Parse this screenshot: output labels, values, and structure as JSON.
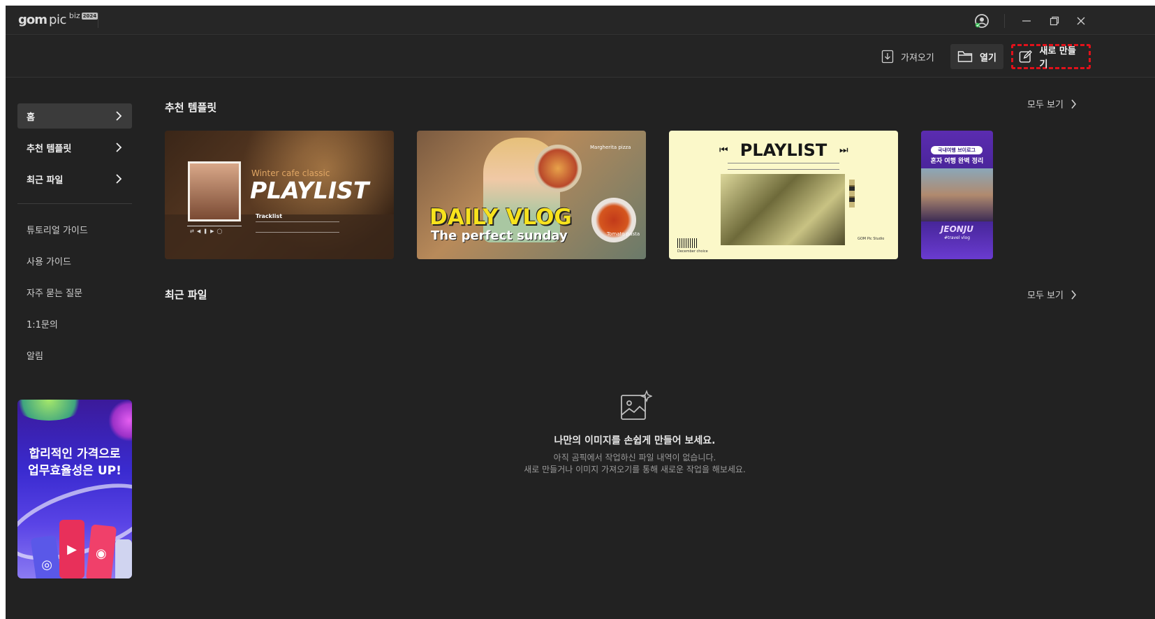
{
  "app": {
    "logo": {
      "brand": "gom",
      "product": "pic",
      "edition": "biz",
      "year": "2024"
    }
  },
  "toolbar": {
    "import_label": "가져오기",
    "open_label": "열기",
    "new_label": "새로 만들기"
  },
  "sidebar": {
    "nav": [
      {
        "label": "홈",
        "active": true
      },
      {
        "label": "추천 템플릿",
        "active": false
      },
      {
        "label": "최근 파일",
        "active": false
      }
    ],
    "guides": [
      "튜토리얼 가이드",
      "사용 가이드",
      "자주 묻는 질문",
      "1:1문의",
      "알림"
    ],
    "ad": {
      "line1": "합리적인 가격으로",
      "line2": "업무효율성은 UP!"
    }
  },
  "main": {
    "templates_title": "추천 템플릿",
    "recent_title": "최근 파일",
    "see_all": "모두 보기",
    "templates": [
      {
        "subtitle": "Winter cafe classic",
        "title": "PLAYLIST",
        "tracklist": "Tracklist"
      },
      {
        "title": "DAILY VLOG",
        "subtitle": "The perfect sunday",
        "note1": "Margherita pizza",
        "note2": "Tomato pasta"
      },
      {
        "title": "PLAYLIST",
        "footer": "December choice",
        "studio": "GOM Pic Studio"
      },
      {
        "tag": "국내여행 브이로그",
        "headline": "혼자 여행 완벽 정리",
        "title": "JEONJU",
        "sub": "#travel vlog"
      }
    ],
    "empty": {
      "title": "나만의 이미지를 손쉽게 만들어 보세요.",
      "line1": "아직 곰픽에서 작업하신 파일 내역이 없습니다.",
      "line2": "새로 만들거나 이미지 가져오기를 통해 새로운 작업을 해보세요."
    }
  },
  "colors": {
    "background": "#222222",
    "highlight_border": "#e0111a",
    "active_nav": "#3b3b3b"
  }
}
